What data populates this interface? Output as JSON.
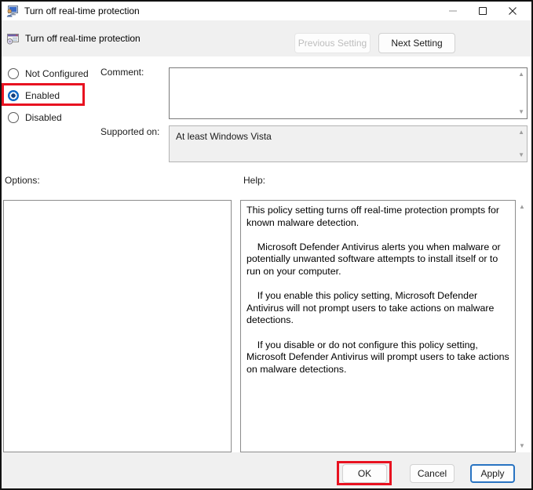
{
  "window": {
    "title": "Turn off real-time protection"
  },
  "icons": {
    "app": "group-policy-monitor-user",
    "policy": "policy-setting-window-disc",
    "scroll_up": "▲",
    "scroll_down": "▼"
  },
  "header": {
    "setting_name": "Turn off real-time protection",
    "previous_button": "Previous Setting",
    "next_button": "Next Setting"
  },
  "state_options": {
    "radios": [
      {
        "label": "Not Configured",
        "selected": false
      },
      {
        "label": "Enabled",
        "selected": true
      },
      {
        "label": "Disabled",
        "selected": false
      }
    ]
  },
  "comment": {
    "label": "Comment:",
    "value": ""
  },
  "supported": {
    "label": "Supported on:",
    "value": "At least Windows Vista"
  },
  "options_panel": {
    "label": "Options:"
  },
  "help_panel": {
    "label": "Help:",
    "text": "This policy setting turns off real-time protection prompts for known malware detection.\n\n    Microsoft Defender Antivirus alerts you when malware or potentially unwanted software attempts to install itself or to run on your computer.\n\n    If you enable this policy setting, Microsoft Defender Antivirus will not prompt users to take actions on malware detections.\n\n    If you disable or do not configure this policy setting, Microsoft Defender Antivirus will prompt users to take actions on malware detections."
  },
  "footer": {
    "ok": "OK",
    "cancel": "Cancel",
    "apply": "Apply"
  },
  "colors": {
    "accent": "#0b64c4",
    "annotation": "#e81220",
    "chrome_bg": "#f0f0f0"
  }
}
